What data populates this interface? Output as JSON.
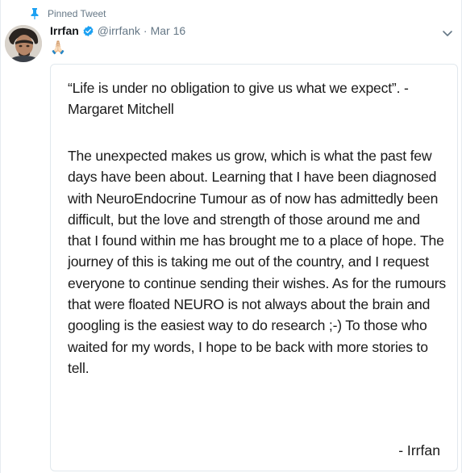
{
  "pinned": {
    "label": "Pinned Tweet",
    "icon": "pin-icon"
  },
  "author": {
    "name": "Irrfan",
    "handle": "@irrfank",
    "separator": "·",
    "date": "Mar 16",
    "verified": true
  },
  "tweet": {
    "emoji": "🙏🏻"
  },
  "media": {
    "quote": "“Life is under no obligation to give us what we expect”. - Margaret Mitchell",
    "body": "The unexpected makes us grow, which is what the past few days have been about. Learning that I have been diagnosed with NeuroEndocrine Tumour as of now has admittedly been difficult, but the love and strength of those around me and that I found within me has brought me to a place of hope. The journey of this is taking me out of the country, and I request everyone to continue sending their wishes. As for the rumours that were floated NEURO is not always about the brain and googling is the easiest way to do research ;-) To those who waited for my words, I hope to be back with more stories to tell.",
    "signature": "- Irrfan"
  },
  "colors": {
    "secondary_text": "#657786",
    "verified_blue": "#1da1f2",
    "border": "#e1e8ed"
  }
}
